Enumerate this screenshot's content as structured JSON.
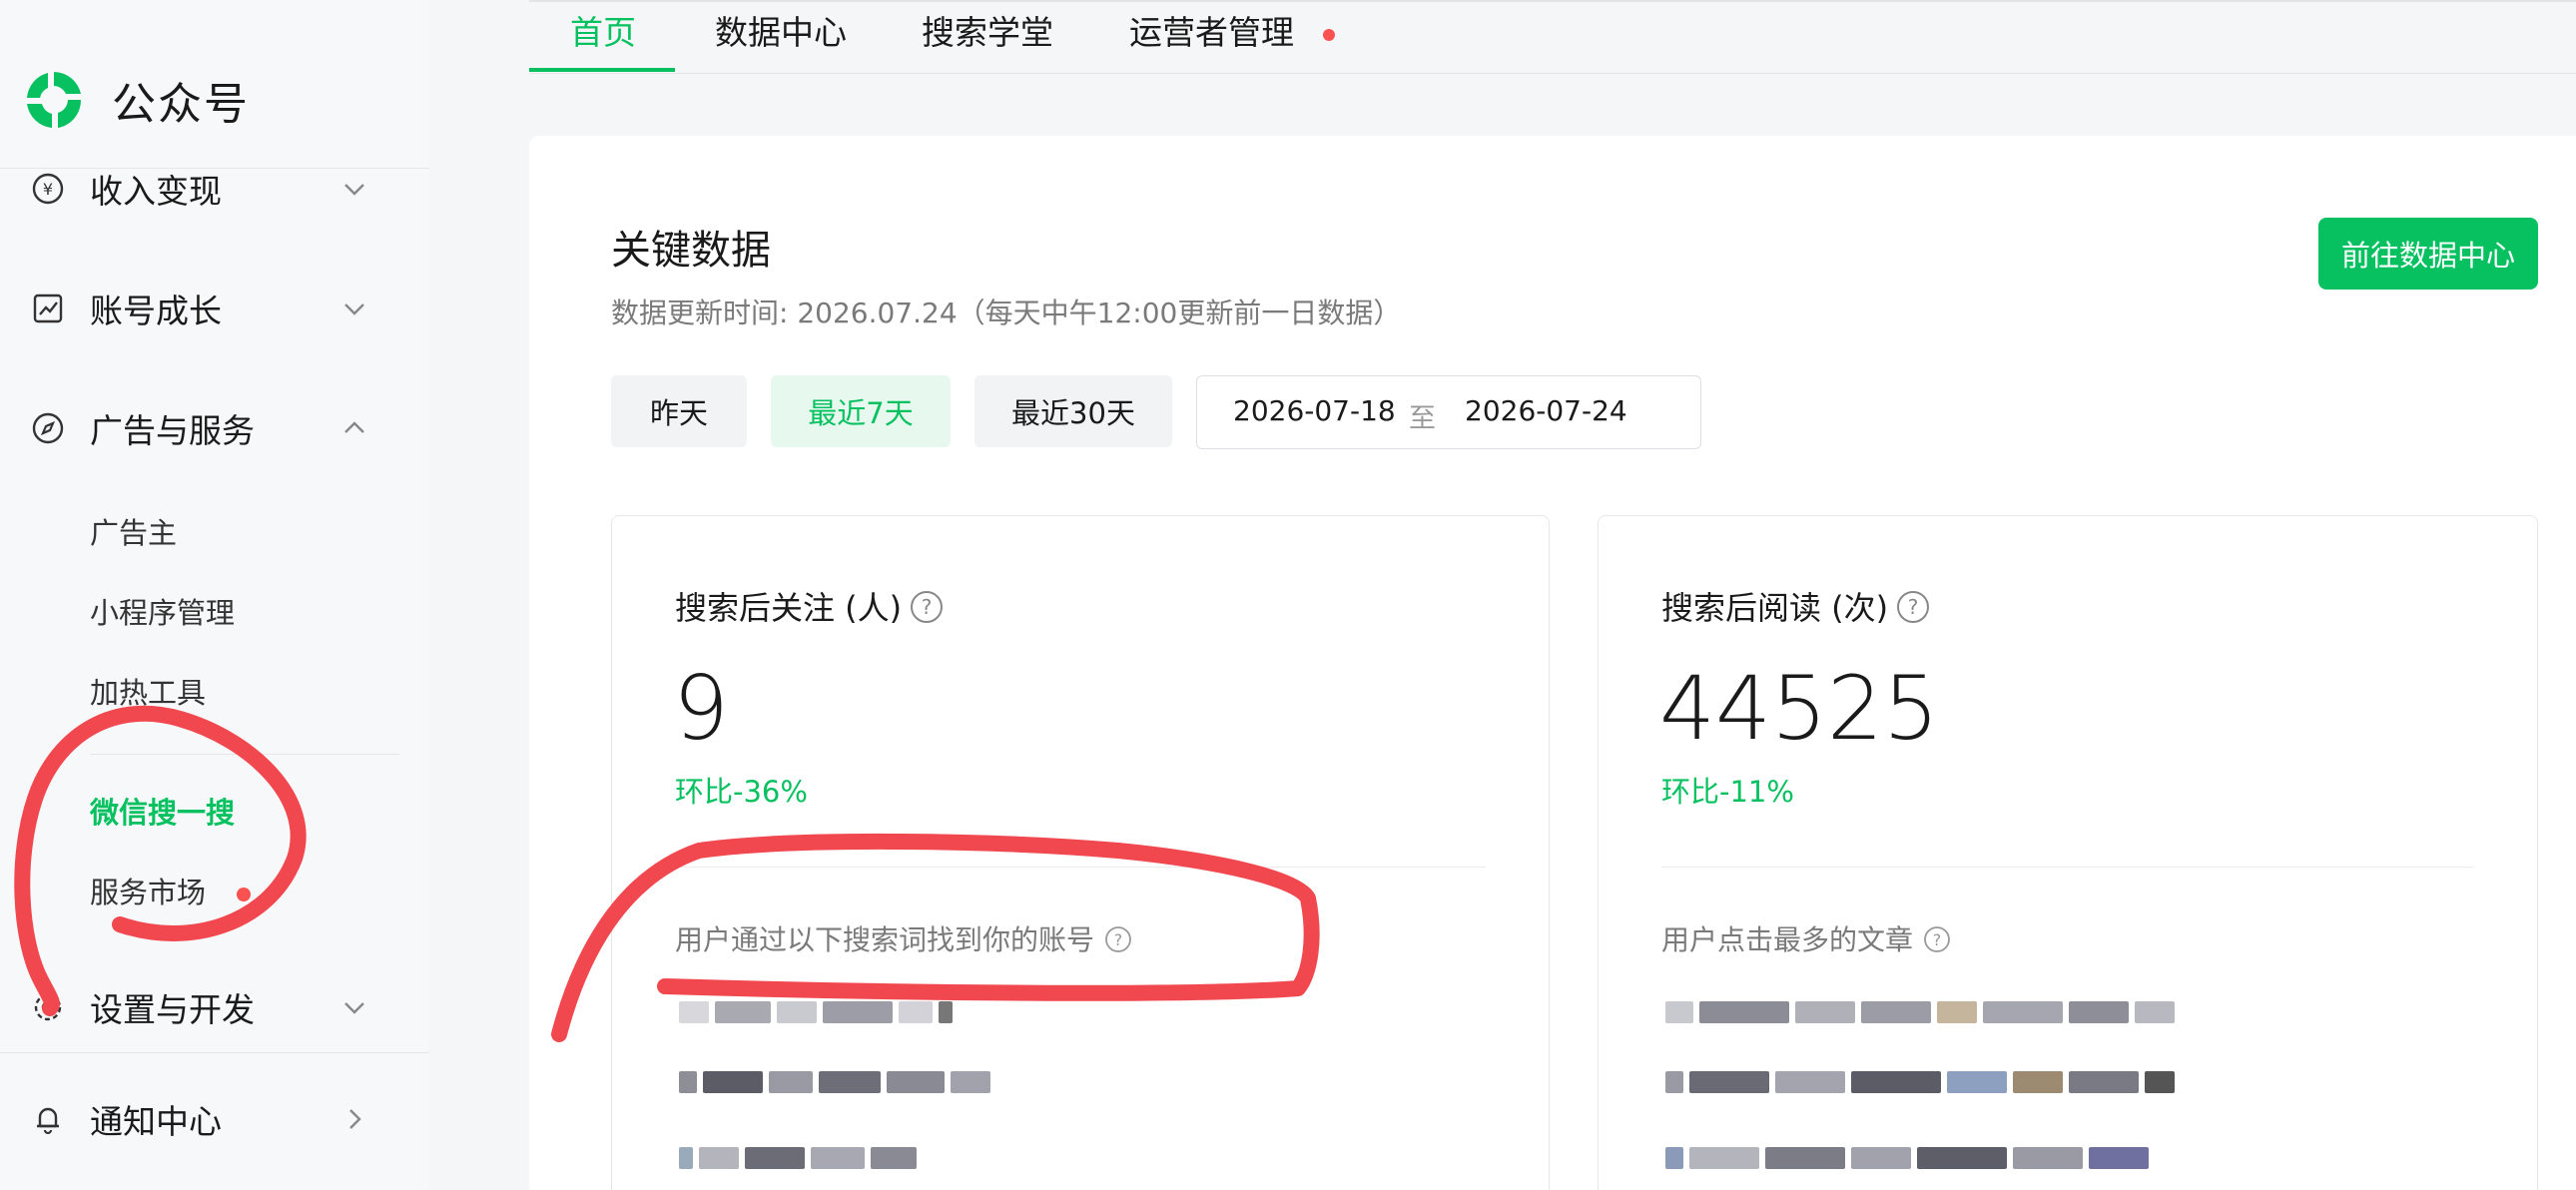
{
  "app": {
    "name": "公众号"
  },
  "top_nav": {
    "tabs": [
      {
        "label": "首页",
        "active": true
      },
      {
        "label": "数据中心",
        "active": false
      },
      {
        "label": "搜索学堂",
        "active": false
      },
      {
        "label": "运营者管理",
        "active": false,
        "dot": true
      }
    ]
  },
  "sidebar": {
    "groups": [
      {
        "label": "收入变现",
        "icon": "yuan-circle-icon",
        "expanded": false
      },
      {
        "label": "账号成长",
        "icon": "chart-trend-icon",
        "expanded": false
      },
      {
        "label": "广告与服务",
        "icon": "compass-icon",
        "expanded": true
      },
      {
        "label": "设置与开发",
        "icon": "gear-icon",
        "expanded": false
      },
      {
        "label": "通知中心",
        "icon": "bell-icon",
        "expanded": false
      }
    ],
    "sub_items": [
      {
        "label": "广告主",
        "active": false
      },
      {
        "label": "小程序管理",
        "active": false
      },
      {
        "label": "加热工具",
        "active": false
      },
      {
        "label": "微信搜一搜",
        "active": true
      },
      {
        "label": "服务市场",
        "active": false,
        "dot": true
      }
    ]
  },
  "main": {
    "title": "关键数据",
    "update_time": "数据更新时间: 2026.07.24（每天中午12:00更新前一日数据）",
    "goto_button": "前往数据中心",
    "ranges": [
      {
        "label": "昨天",
        "active": false
      },
      {
        "label": "最近7天",
        "active": true
      },
      {
        "label": "最近30天",
        "active": false
      }
    ],
    "date_range": {
      "start": "2026-07-18",
      "separator": "至",
      "end": "2026-07-24"
    },
    "metrics": [
      {
        "label": "搜索后关注 (人)",
        "value": "9",
        "change": "环比-36%",
        "section_label": "用户通过以下搜索词找到你的账号"
      },
      {
        "label": "搜索后阅读 (次)",
        "value": "44525",
        "change": "环比-11%",
        "section_label": "用户点击最多的文章"
      }
    ]
  },
  "colors": {
    "brand_green": "#07c160",
    "red_dot": "#fa5151",
    "annotation_red": "#f0484e"
  }
}
